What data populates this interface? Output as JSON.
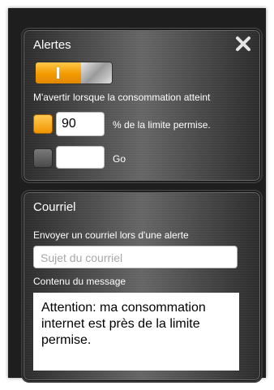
{
  "alerts": {
    "title": "Alertes",
    "close_icon": "close-x-icon",
    "toggle_on": true,
    "notify_label": "M'avertir lorsque la consommation atteint",
    "percent_enabled": true,
    "percent_value": "90",
    "percent_label": "% de la limite permise.",
    "go_enabled": false,
    "go_value": "",
    "go_label": "Go"
  },
  "email": {
    "title": "Courriel",
    "send_label": "Envoyer un courriel lors d'une alerte",
    "subject_placeholder": "Sujet du courriel",
    "content_label": "Contenu du message",
    "message": "Attention: ma consommation internet est près de la limite permise."
  },
  "colors": {
    "accent": "#f39a00",
    "panel_dark": "#2b2b2b",
    "panel_light": "#666666"
  }
}
